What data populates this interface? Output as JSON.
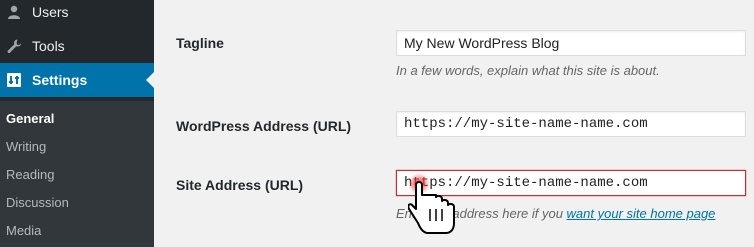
{
  "sidebar": {
    "menu": [
      {
        "label": "Users",
        "icon": "users-icon"
      },
      {
        "label": "Tools",
        "icon": "wrench-icon"
      },
      {
        "label": "Settings",
        "icon": "settings-icon",
        "current": true
      }
    ],
    "submenu": [
      "General",
      "Writing",
      "Reading",
      "Discussion",
      "Media"
    ],
    "active_submenu": "General"
  },
  "form": {
    "tagline": {
      "label": "Tagline",
      "value": "My New WordPress Blog",
      "description": "In a few words, explain what this site is about."
    },
    "wordpress_address": {
      "label": "WordPress Address (URL)",
      "value": "https://my-site-name-name.com"
    },
    "site_address": {
      "label": "Site Address (URL)",
      "value": "https://my-site-name-name.com",
      "description_prefix": "Enter the address here if you ",
      "description_link": "want your site home page"
    }
  },
  "colors": {
    "sidebar_bg": "#23282d",
    "submenu_bg": "#32373c",
    "accent": "#0073aa",
    "highlight_border": "#d22a2a"
  }
}
